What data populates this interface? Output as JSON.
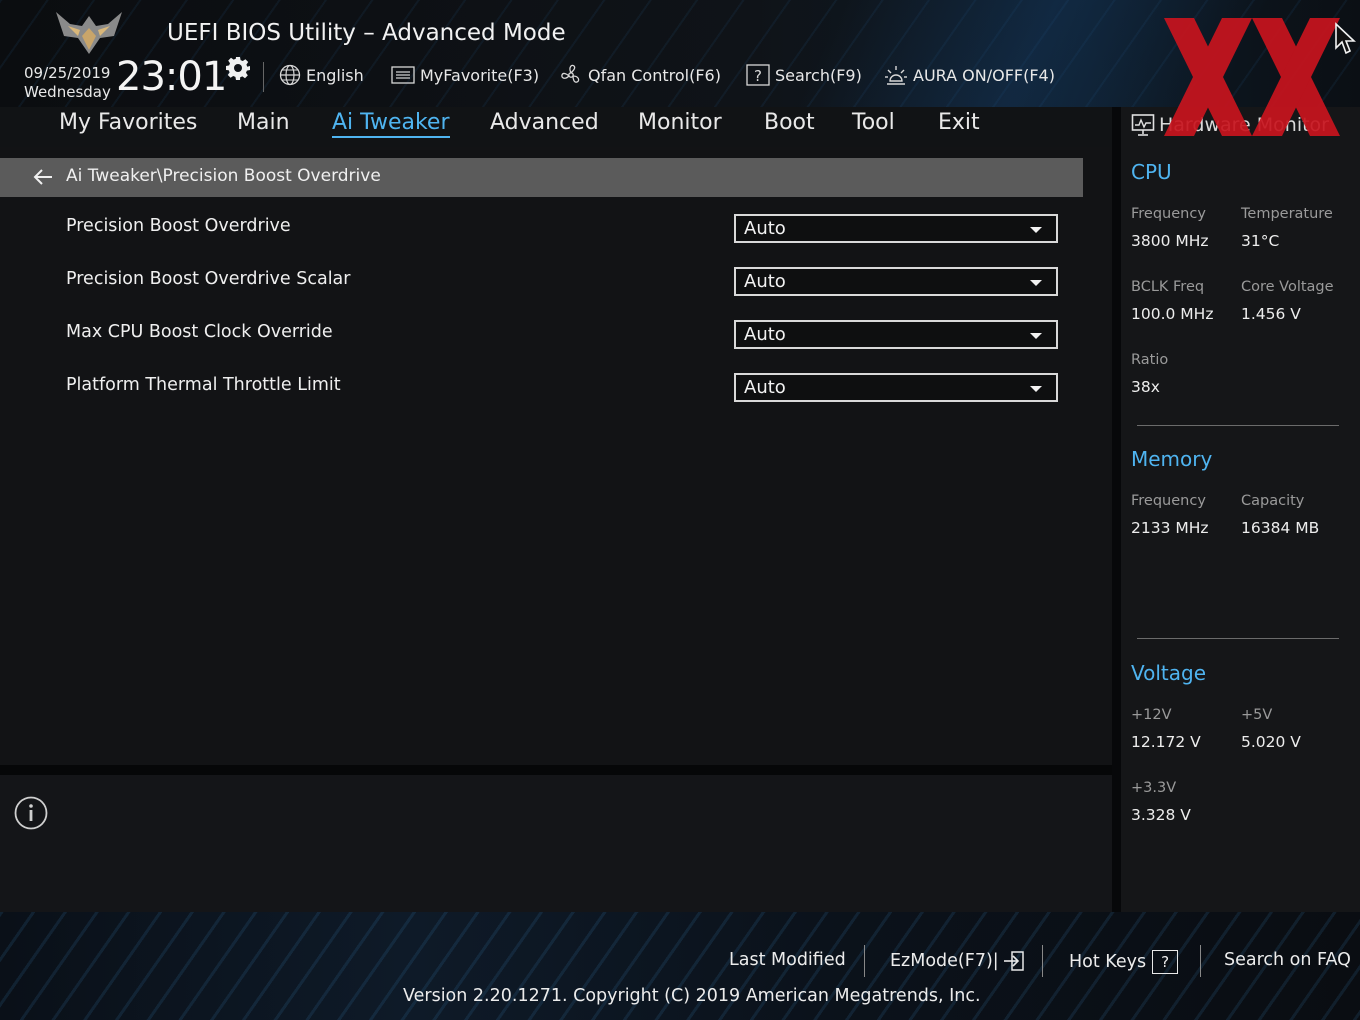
{
  "header": {
    "title": "UEFI BIOS Utility – Advanced Mode",
    "date": "09/25/2019",
    "weekday": "Wednesday",
    "time": "23:01",
    "toolbar": {
      "language": "English",
      "favorite": "MyFavorite(F3)",
      "qfan": "Qfan Control(F6)",
      "search": "Search(F9)",
      "aura": "AURA ON/OFF(F4)"
    }
  },
  "nav": {
    "tabs": [
      {
        "label": "My Favorites"
      },
      {
        "label": "Main"
      },
      {
        "label": "Ai Tweaker"
      },
      {
        "label": "Advanced"
      },
      {
        "label": "Monitor"
      },
      {
        "label": "Boot"
      },
      {
        "label": "Tool"
      },
      {
        "label": "Exit"
      }
    ],
    "active": "Ai Tweaker"
  },
  "breadcrumb": "Ai Tweaker\\Precision Boost Overdrive",
  "settings": [
    {
      "label": "Precision Boost Overdrive",
      "value": "Auto"
    },
    {
      "label": "Precision Boost Overdrive Scalar",
      "value": "Auto"
    },
    {
      "label": "Max CPU Boost Clock Override",
      "value": "Auto"
    },
    {
      "label": "Platform Thermal Throttle Limit",
      "value": "Auto"
    }
  ],
  "hardware_monitor": {
    "title": "Hardware Monitor",
    "cpu": {
      "heading": "CPU",
      "frequency_label": "Frequency",
      "frequency": "3800 MHz",
      "temperature_label": "Temperature",
      "temperature": "31°C",
      "bclk_label": "BCLK Freq",
      "bclk": "100.0 MHz",
      "core_voltage_label": "Core Voltage",
      "core_voltage": "1.456 V",
      "ratio_label": "Ratio",
      "ratio": "38x"
    },
    "memory": {
      "heading": "Memory",
      "frequency_label": "Frequency",
      "frequency": "2133 MHz",
      "capacity_label": "Capacity",
      "capacity": "16384 MB"
    },
    "voltage": {
      "heading": "Voltage",
      "v12_label": "+12V",
      "v12": "12.172 V",
      "v5_label": "+5V",
      "v5": "5.020 V",
      "v33_label": "+3.3V",
      "v33": "3.328 V"
    }
  },
  "footer": {
    "last_modified": "Last Modified",
    "ezmode": "EzMode(F7)|",
    "hot_keys": "Hot Keys",
    "hot_keys_key": "?",
    "search_faq": "Search on FAQ",
    "version": "Version 2.20.1271. Copyright (C) 2019 American Megatrends, Inc."
  },
  "colors": {
    "accent": "#4fb4f0",
    "watermark": "#c8141e",
    "breadcrumb_bg": "#5b5b5b"
  }
}
